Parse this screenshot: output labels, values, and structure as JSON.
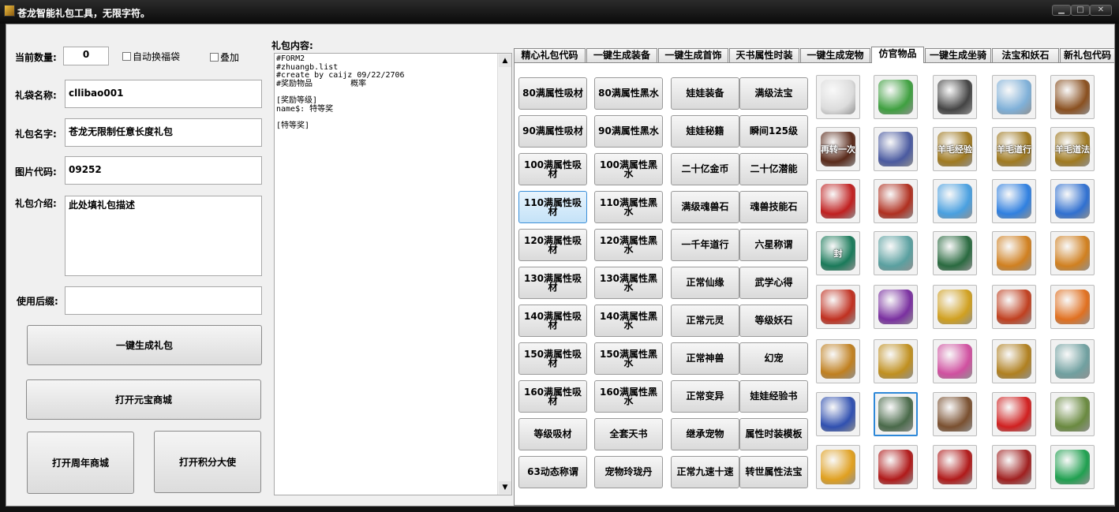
{
  "window": {
    "title": "苍龙智能礼包工具，无限字符。",
    "min": "▁",
    "max": "□",
    "close": "✕"
  },
  "left": {
    "count_label": "当前数量:",
    "count_value": "0",
    "auto_label": "自动换福袋",
    "stack_label": "叠加",
    "bag_name_label": "礼袋名称:",
    "bag_name_value": "cllibao001",
    "pack_name_label": "礼包名字:",
    "pack_name_value": "苍龙无限制任意长度礼包",
    "image_code_label": "图片代码:",
    "image_code_value": "09252",
    "desc_label": "礼包介绍:",
    "desc_value": "此处填礼包描述",
    "suffix_label": "使用后缀:",
    "suffix_value": "",
    "generate_btn": "一键生成礼包",
    "shop_btn": "打开元宝商城",
    "anniv_btn": "打开周年商城",
    "points_btn": "打开积分大使"
  },
  "content": {
    "label": "礼包内容:",
    "text": "#FORM2\n#zhuangb.list\n#create by caijz 09/22/2706\n#奖励物品        概率\n\n[奖励等级]\nname$: 特等奖\n\n[特等奖]",
    "up": "▲",
    "down": "▼"
  },
  "tabs": [
    "精心礼包代码",
    "一键生成装备",
    "一键生成首饰",
    "天书属性时装",
    "一键生成宠物",
    "仿官物品",
    "一键生成坐骑",
    "法宝和妖石",
    "新礼包代码"
  ],
  "active_tab": 5,
  "grid": [
    [
      "80满属性吸材",
      "80满属性黑水",
      "娃娃装备",
      "满级法宝"
    ],
    [
      "90满属性吸材",
      "90满属性黑水",
      "娃娃秘籍",
      "瞬间125级"
    ],
    [
      "100满属性吸材",
      "100满属性黑水",
      "二十亿金币",
      "二十亿潜能"
    ],
    [
      "110满属性吸材",
      "110满属性黑水",
      "满级魂兽石",
      "魂兽技能石"
    ],
    [
      "120满属性吸材",
      "120满属性黑水",
      "一千年道行",
      "六星称谓"
    ],
    [
      "130满属性吸材",
      "130满属性黑水",
      "正常仙缘",
      "武学心得"
    ],
    [
      "140满属性吸材",
      "140满属性黑水",
      "正常元灵",
      "等级妖石"
    ],
    [
      "150满属性吸材",
      "150满属性黑水",
      "正常神兽",
      "幻宠"
    ],
    [
      "160满属性吸材",
      "160满属性黑水",
      "正常变异",
      "娃娃经验书"
    ],
    [
      "等级吸材",
      "全套天书",
      "继承宠物",
      "属性时装模板"
    ],
    [
      "63动态称谓",
      "宠物玲珑丹",
      "正常九速十速",
      "转世属性法宝"
    ]
  ],
  "selected_grid_cell": "110满属性吸材",
  "icons": [
    [
      {
        "n": "teapot-icon",
        "c": "#dcdcdc",
        "t": ""
      },
      {
        "n": "jade-ring-icon",
        "c": "#3fa040",
        "t": ""
      },
      {
        "n": "orb-icon",
        "c": "#444",
        "t": ""
      },
      {
        "n": "lightning-gem-icon",
        "c": "#7fb0d8",
        "t": ""
      },
      {
        "n": "treasure-chest-icon",
        "c": "#8a5020",
        "t": ""
      }
    ],
    [
      {
        "n": "rebirth-token-icon",
        "c": "#5a2a1a",
        "t": "再转一次"
      },
      {
        "n": "incense-burner-icon",
        "c": "#4a5aa0",
        "t": ""
      },
      {
        "n": "exp-scroll-icon",
        "c": "#a07a20",
        "t": "羊毛经验"
      },
      {
        "n": "dao-scroll-icon",
        "c": "#a07a20",
        "t": "羊毛道行"
      },
      {
        "n": "magic-scroll-icon",
        "c": "#a07a20",
        "t": "羊毛道法"
      }
    ],
    [
      {
        "n": "red-crystal-icon",
        "c": "#c02020",
        "t": ""
      },
      {
        "n": "red-orb-icon",
        "c": "#b03020",
        "t": ""
      },
      {
        "n": "blue-feather-icon",
        "c": "#4aa0e0",
        "t": ""
      },
      {
        "n": "blue-shard-icon",
        "c": "#3080e0",
        "t": ""
      },
      {
        "n": "water-drop-icon",
        "c": "#3070d0",
        "t": ""
      }
    ],
    [
      {
        "n": "seal-lock-icon",
        "c": "#1a7a5a",
        "t": "封"
      },
      {
        "n": "bottle-icon",
        "c": "#5aa0a0",
        "t": ""
      },
      {
        "n": "green-scroll-icon",
        "c": "#2a6a40",
        "t": ""
      },
      {
        "n": "gold-book-icon",
        "c": "#d08020",
        "t": ""
      },
      {
        "n": "gold-book-2-icon",
        "c": "#d08020",
        "t": ""
      }
    ],
    [
      {
        "n": "red-necklace-icon",
        "c": "#c03020",
        "t": ""
      },
      {
        "n": "purple-boot-icon",
        "c": "#7a30a0",
        "t": ""
      },
      {
        "n": "gold-dragon-icon",
        "c": "#d0a020",
        "t": ""
      },
      {
        "n": "mirror-icon",
        "c": "#c04020",
        "t": ""
      },
      {
        "n": "gourd-icon",
        "c": "#e07020",
        "t": ""
      }
    ],
    [
      {
        "n": "gold-crown-icon",
        "c": "#c08020",
        "t": ""
      },
      {
        "n": "gold-seal-icon",
        "c": "#c09020",
        "t": ""
      },
      {
        "n": "lotus-icon",
        "c": "#d050a0",
        "t": ""
      },
      {
        "n": "gold-statue-icon",
        "c": "#b08020",
        "t": ""
      },
      {
        "n": "crossed-swords-icon",
        "c": "#70a0a0",
        "t": ""
      }
    ],
    [
      {
        "n": "golden-face-card-icon",
        "c": "#3050b0",
        "t": ""
      },
      {
        "n": "coin-stack-icon",
        "c": "#4a6a4a",
        "t": ""
      },
      {
        "n": "bird-cage-icon",
        "c": "#7a5030",
        "t": ""
      },
      {
        "n": "red-envelope-icon",
        "c": "#d02020",
        "t": ""
      },
      {
        "n": "mahjong-icon",
        "c": "#6a8a40",
        "t": ""
      }
    ],
    [
      {
        "n": "gold-ingot-icon",
        "c": "#e0a020",
        "t": ""
      },
      {
        "n": "red-gift-card-icon",
        "c": "#b01a1a",
        "t": ""
      },
      {
        "n": "red-gift-card-2-icon",
        "c": "#b01a1a",
        "t": ""
      },
      {
        "n": "lucky-bag-icon",
        "c": "#a02020",
        "t": ""
      },
      {
        "n": "jade-sword-icon",
        "c": "#20a050",
        "t": ""
      }
    ]
  ]
}
